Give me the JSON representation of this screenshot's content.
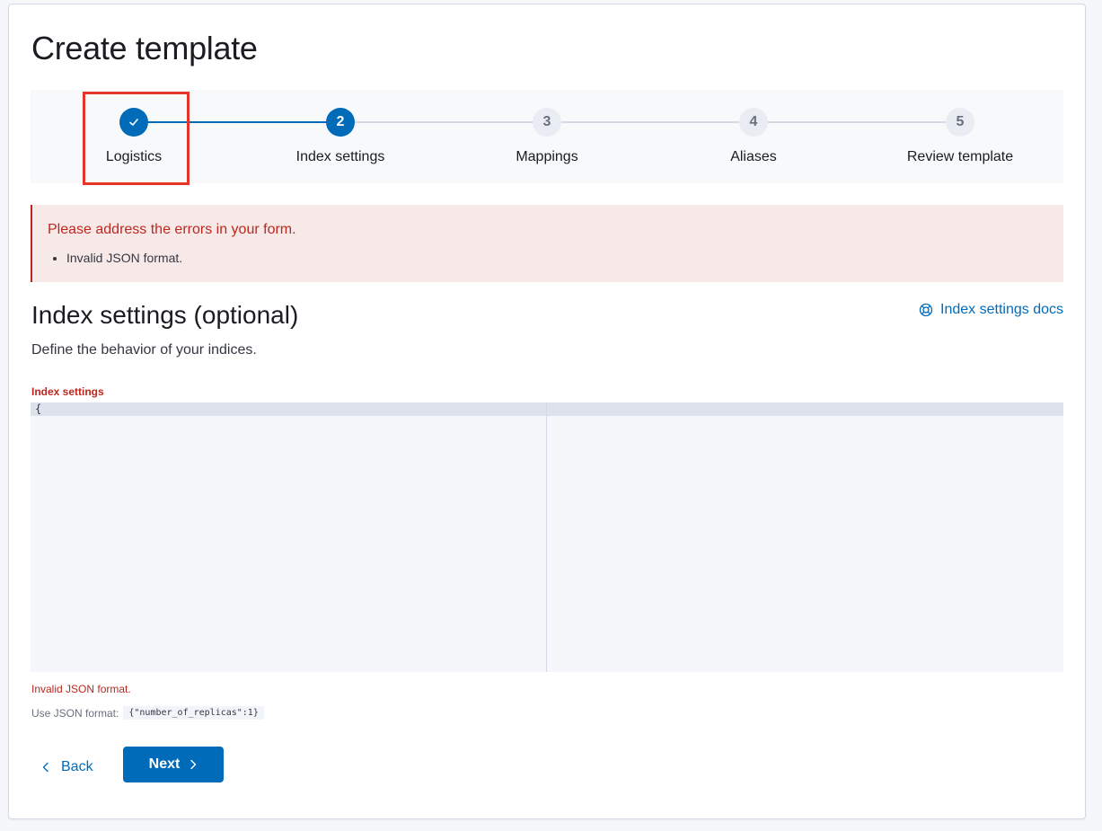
{
  "page": {
    "title": "Create template"
  },
  "steps": [
    {
      "number": "1",
      "label": "Logistics",
      "state": "complete"
    },
    {
      "number": "2",
      "label": "Index settings",
      "state": "current"
    },
    {
      "number": "3",
      "label": "Mappings",
      "state": "todo"
    },
    {
      "number": "4",
      "label": "Aliases",
      "state": "todo"
    },
    {
      "number": "5",
      "label": "Review template",
      "state": "todo"
    }
  ],
  "callout": {
    "title": "Please address the errors in your form.",
    "errors": [
      "Invalid JSON format."
    ]
  },
  "section": {
    "title": "Index settings (optional)",
    "description": "Define the behavior of your indices.",
    "docs_link": "Index settings docs"
  },
  "editor": {
    "label": "Index settings",
    "content": "{",
    "error": "Invalid JSON format.",
    "help_prefix": "Use JSON format:",
    "help_code": "{\"number_of_replicas\":1}"
  },
  "buttons": {
    "back": "Back",
    "next": "Next"
  },
  "colors": {
    "primary": "#006bb8",
    "danger": "#bd271e",
    "highlight": "#e5342a"
  }
}
